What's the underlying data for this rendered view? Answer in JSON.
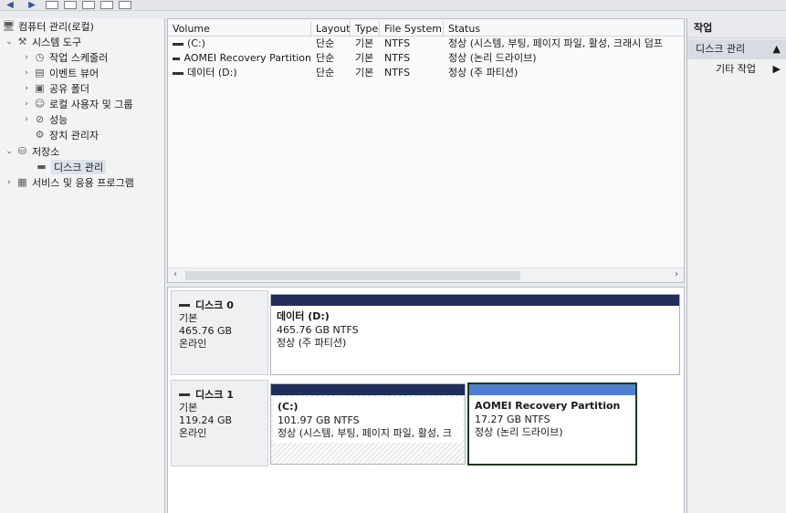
{
  "tree": {
    "root": "컴퓨터 관리(로컬)",
    "system_tools": "시스템 도구",
    "task_scheduler": "작업 스케줄러",
    "event_viewer": "이벤트 뷰어",
    "shared_folders": "공유 폴더",
    "local_users": "로컬 사용자 및 그룹",
    "performance": "성능",
    "device_manager": "장치 관리자",
    "storage": "저장소",
    "disk_management": "디스크 관리",
    "services_apps": "서비스 및 응용 프로그램"
  },
  "volume_list": {
    "columns": [
      "Volume",
      "Layout",
      "Type",
      "File System",
      "Status"
    ],
    "rows": [
      {
        "volume": "(C:)",
        "layout": "단순",
        "type": "기본",
        "fs": "NTFS",
        "status": "정상 (시스템, 부팅, 페이지 파일, 활성, 크래시 덤프"
      },
      {
        "volume": "AOMEI Recovery Partition",
        "layout": "단순",
        "type": "기본",
        "fs": "NTFS",
        "status": "정상 (논리 드라이브)"
      },
      {
        "volume": "데이터 (D:)",
        "layout": "단순",
        "type": "기본",
        "fs": "NTFS",
        "status": "정상 (주 파티션)"
      }
    ]
  },
  "disks": [
    {
      "name": "디스크 0",
      "kind": "기본",
      "size": "465.76 GB",
      "state": "온라인",
      "partitions": [
        {
          "name": "데이터  (D:)",
          "size": "465.76 GB NTFS",
          "status": "정상 (주 파티션)"
        }
      ]
    },
    {
      "name": "디스크 1",
      "kind": "기본",
      "size": "119.24 GB",
      "state": "온라인",
      "partitions": [
        {
          "name": "(C:)",
          "size": "101.97 GB NTFS",
          "status": "정상 (시스템, 부팅, 페이지 파일, 활성, 크"
        },
        {
          "name": "AOMEI Recovery Partition",
          "size": "17.27 GB NTFS",
          "status": "정상 (논리 드라이브)"
        }
      ]
    }
  ],
  "actions": {
    "header": "작업",
    "section": "디스크 관리",
    "section_arrow": "▲",
    "more": "기타 작업",
    "more_arrow": "▶"
  },
  "icons": {
    "back": "back-arrow-icon",
    "forward": "forward-arrow-icon"
  },
  "colors": {
    "primary_partition_header": "#1f2e5a",
    "logical_partition_header": "#4f7fd1"
  }
}
